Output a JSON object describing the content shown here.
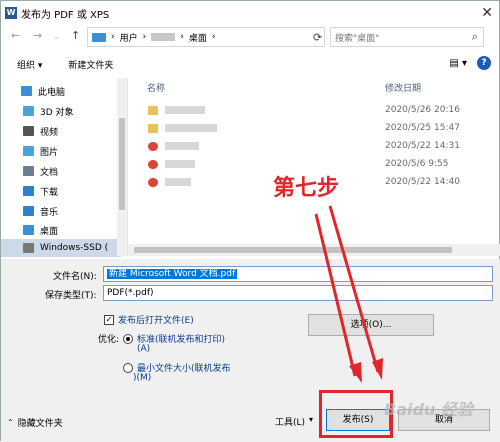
{
  "window": {
    "title": "发布为 PDF 或 XPS",
    "close": "✕"
  },
  "address": {
    "back": "←",
    "forward": "→",
    "up": "↑",
    "path": [
      "用户",
      "桌面"
    ],
    "sep": "›",
    "search_placeholder": "搜索\"桌面\""
  },
  "toolbar": {
    "organize": "组织 ▾",
    "new_folder": "新建文件夹",
    "help": "?"
  },
  "nav": {
    "items": [
      {
        "label": "此电脑",
        "icon": "pc-icon",
        "color": "#3b8fd6"
      },
      {
        "label": "3D 对象",
        "icon": "3d-objects-icon",
        "color": "#4aa3df"
      },
      {
        "label": "视频",
        "icon": "video-icon",
        "color": "#555"
      },
      {
        "label": "图片",
        "icon": "pictures-icon",
        "color": "#4aa3df"
      },
      {
        "label": "文档",
        "icon": "documents-icon",
        "color": "#6a7d93"
      },
      {
        "label": "下载",
        "icon": "downloads-icon",
        "color": "#2d7fd0"
      },
      {
        "label": "音乐",
        "icon": "music-icon",
        "color": "#2d7fd0"
      },
      {
        "label": "桌面",
        "icon": "desktop-icon",
        "color": "#3b8fd6"
      },
      {
        "label": "Windows-SSD (",
        "icon": "drive-icon",
        "color": "#777"
      }
    ]
  },
  "list": {
    "headers": {
      "name": "名称",
      "date": "修改日期"
    },
    "rows": [
      {
        "date": "2020/5/26 20:16",
        "icon_color": "#e8c15a"
      },
      {
        "date": "2020/5/25 15:47",
        "icon_color": "#e8c15a"
      },
      {
        "date": "2020/5/22 14:31",
        "icon_color": "#db4437"
      },
      {
        "date": "2020/5/6 9:55",
        "icon_color": "#db4437"
      },
      {
        "date": "2020/5/22 14:40",
        "icon_color": "#db4437"
      }
    ]
  },
  "form": {
    "filename_label": "文件名(N):",
    "filename_value": "新建 Microsoft Word 文档.pdf",
    "type_label": "保存类型(T):",
    "type_value": "PDF(*.pdf)",
    "open_after": "发布后打开文件(E)",
    "optimize_label": "优化:",
    "opt_standard": "标准(联机发布和打印)",
    "opt_standard_key": "(A)",
    "opt_min": "最小文件大小(联机发布",
    "opt_min_key": ")(M)",
    "options_btn": "选项(O)...",
    "tools": "工具(L)",
    "publish": "发布(S)",
    "cancel": "取消",
    "hide_folders": "隐藏文件夹"
  },
  "annotation": {
    "step": "第七步",
    "color": "#e0262b"
  },
  "watermark": "Baidu 经验"
}
